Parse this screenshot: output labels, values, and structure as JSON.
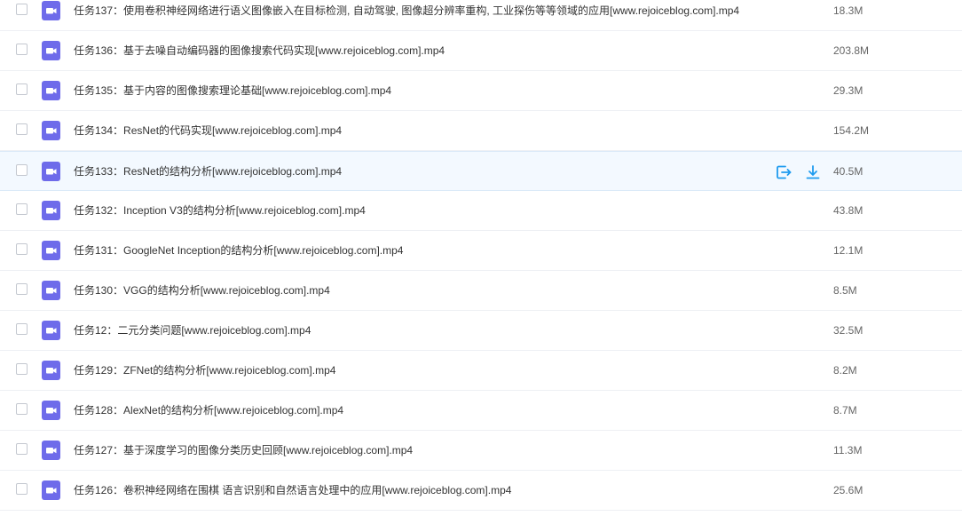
{
  "colors": {
    "video_icon": "#6e6bea",
    "action_icon": "#1e9bef",
    "hover_row": "#f3f9ff"
  },
  "hovered_row_actions": {
    "share_icon": "share-icon",
    "download_icon": "download-icon"
  },
  "files": [
    {
      "name": "任务137：使用卷积神经网络进行语义图像嵌入在目标检测, 自动驾驶, 图像超分辨率重构, 工业探伤等等领域的应用[www.rejoiceblog.com].mp4",
      "size": "18.3M"
    },
    {
      "name": "任务136：基于去噪自动编码器的图像搜索代码实现[www.rejoiceblog.com].mp4",
      "size": "203.8M"
    },
    {
      "name": "任务135：基于内容的图像搜索理论基础[www.rejoiceblog.com].mp4",
      "size": "29.3M"
    },
    {
      "name": "任务134：ResNet的代码实现[www.rejoiceblog.com].mp4",
      "size": "154.2M"
    },
    {
      "name": "任务133：ResNet的结构分析[www.rejoiceblog.com].mp4",
      "size": "40.5M",
      "hovered": true
    },
    {
      "name": "任务132：Inception V3的结构分析[www.rejoiceblog.com].mp4",
      "size": "43.8M"
    },
    {
      "name": "任务131：GoogleNet Inception的结构分析[www.rejoiceblog.com].mp4",
      "size": "12.1M"
    },
    {
      "name": "任务130：VGG的结构分析[www.rejoiceblog.com].mp4",
      "size": "8.5M"
    },
    {
      "name": "任务12：二元分类问题[www.rejoiceblog.com].mp4",
      "size": "32.5M"
    },
    {
      "name": "任务129：ZFNet的结构分析[www.rejoiceblog.com].mp4",
      "size": "8.2M"
    },
    {
      "name": "任务128：AlexNet的结构分析[www.rejoiceblog.com].mp4",
      "size": "8.7M"
    },
    {
      "name": "任务127：基于深度学习的图像分类历史回顾[www.rejoiceblog.com].mp4",
      "size": "11.3M"
    },
    {
      "name": "任务126：卷积神经网络在围棋 语言识别和自然语言处理中的应用[www.rejoiceblog.com].mp4",
      "size": "25.6M"
    }
  ]
}
